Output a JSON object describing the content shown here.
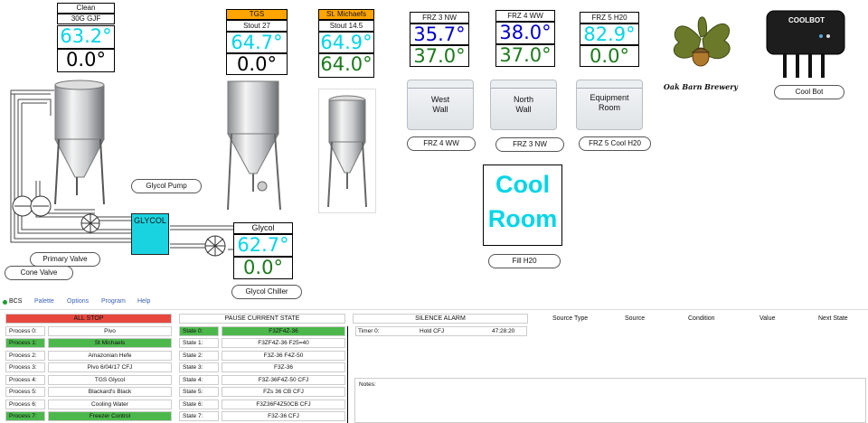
{
  "clean_tank": {
    "status": "Clean",
    "name": "30G GJF",
    "temp": "63.2°",
    "setpoint": "0.0°"
  },
  "tgs_tank": {
    "brand": "TGS",
    "beer": "Stout 27",
    "temp": "64.7°",
    "setpoint": "0.0°"
  },
  "stmichaels_tank": {
    "brand": "St. Michaefs",
    "beer": "Stout 14.5",
    "temp": "64.9°",
    "setpoint": "64.0°"
  },
  "frz3": {
    "name": "FRZ 3 NW",
    "temp": "35.7°",
    "setpoint": "37.0°"
  },
  "frz4": {
    "name": "FRZ 4 WW",
    "temp": "38.0°",
    "setpoint": "37.0°"
  },
  "frz5": {
    "name": "FRZ 5 H20",
    "temp": "82.9°",
    "setpoint": "0.0°"
  },
  "freezers": [
    {
      "label": "West\nWall",
      "button": "FRZ 4 WW"
    },
    {
      "label": "North\nWall",
      "button": "FRZ 3 NW"
    },
    {
      "label": "Equipment\nRoom",
      "button": "FRZ 5 Cool H20"
    }
  ],
  "brewery_logo": "Oak Barn Brewery",
  "coolbot": {
    "brand": "COOLBOT",
    "button": "Cool Bot"
  },
  "cool_room": {
    "line1": "Cool",
    "line2": "Room",
    "button": "Fill H20"
  },
  "glycol": {
    "tank_label": "GLYCOL",
    "name": "Glycol",
    "temp": "62.7°",
    "setpoint": "0.0°",
    "chiller_button": "Glycol Chiller",
    "pump_button": "Glycol Pump"
  },
  "valves": {
    "primary": "Primary Valve",
    "cone": "Cone Valve"
  },
  "tabs": [
    "BCS",
    "Palette",
    "Options",
    "Program",
    "Help"
  ],
  "controls": {
    "all_stop": "ALL STOP",
    "pause": "PAUSE CURRENT STATE",
    "silence": "SILENCE ALARM"
  },
  "processes": [
    {
      "label": "Process 0:",
      "value": "Pivo",
      "selected": false
    },
    {
      "label": "Process 1:",
      "value": "St Michaels",
      "selected": true
    },
    {
      "label": "Process 2:",
      "value": "Amazonian Hefe",
      "selected": false
    },
    {
      "label": "Process 3:",
      "value": "Pivo 6/04/17 CFJ",
      "selected": false
    },
    {
      "label": "Process 4:",
      "value": "TGS Glycol",
      "selected": false
    },
    {
      "label": "Process 5:",
      "value": "Blackard's Black",
      "selected": false
    },
    {
      "label": "Process 6:",
      "value": "Cooling Water",
      "selected": false
    },
    {
      "label": "Process 7:",
      "value": "Freezer Control",
      "selected": true
    }
  ],
  "states": [
    {
      "label": "State 0:",
      "value": "F3ZF4Z-36",
      "selected": true
    },
    {
      "label": "State 1:",
      "value": "F3ZF4Z-36 F25=40",
      "selected": false
    },
    {
      "label": "State 2:",
      "value": "F3Z-36 F4Z-50",
      "selected": false
    },
    {
      "label": "State 3:",
      "value": "F3Z-36",
      "selected": false
    },
    {
      "label": "State 4:",
      "value": "F3Z-36F4Z-50 CFJ",
      "selected": false
    },
    {
      "label": "State 5:",
      "value": "FZs 36 CB CFJ",
      "selected": false
    },
    {
      "label": "State 6:",
      "value": "F3Z36F4Z50CB CFJ",
      "selected": false
    },
    {
      "label": "State 7:",
      "value": "F3Z-36 CFJ",
      "selected": false
    }
  ],
  "timer": {
    "label": "Timer 0:",
    "name": "Hold CFJ",
    "time": "47:28:20"
  },
  "exit_headers": [
    "Source Type",
    "Source",
    "Condition",
    "Value",
    "Next State"
  ],
  "notes_label": "Notes:"
}
